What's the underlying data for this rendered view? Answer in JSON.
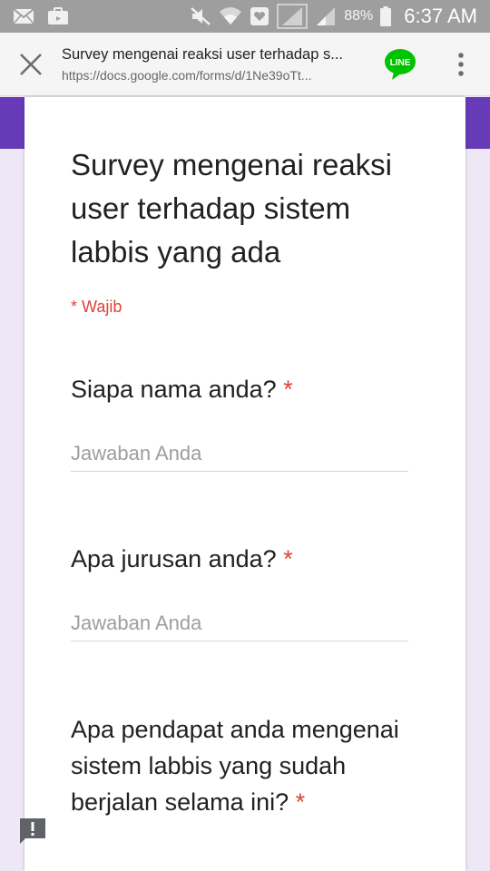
{
  "status_bar": {
    "battery": "88%",
    "time": "6:37 AM",
    "left_icons": [
      "mail-icon",
      "briefcase-icon"
    ],
    "right_icons": [
      "mute-icon",
      "wifi-icon",
      "heart-icon",
      "signal-icon",
      "signal-icon"
    ]
  },
  "browser": {
    "title": "Survey mengenai reaksi user terhadap s...",
    "url": "https://docs.google.com/forms/d/1Ne39oTt...",
    "share_app_label": "LINE"
  },
  "form": {
    "title": "Survey mengenai reaksi user terhadap sistem labbis yang ada",
    "required_note": "* Wajib",
    "questions": [
      {
        "text": "Siapa nama anda?",
        "required_mark": "*",
        "placeholder": "Jawaban Anda"
      },
      {
        "text": "Apa jurusan anda?",
        "required_mark": "*",
        "placeholder": "Jawaban Anda"
      },
      {
        "text": "Apa pendapat anda mengenai sistem labbis yang sudah berjalan selama ini?",
        "required_mark": "*"
      }
    ]
  },
  "colors": {
    "theme_purple": "#673ab7",
    "background_lavender": "#ede7f6",
    "required_red": "#db4437",
    "line_green": "#00c300"
  }
}
